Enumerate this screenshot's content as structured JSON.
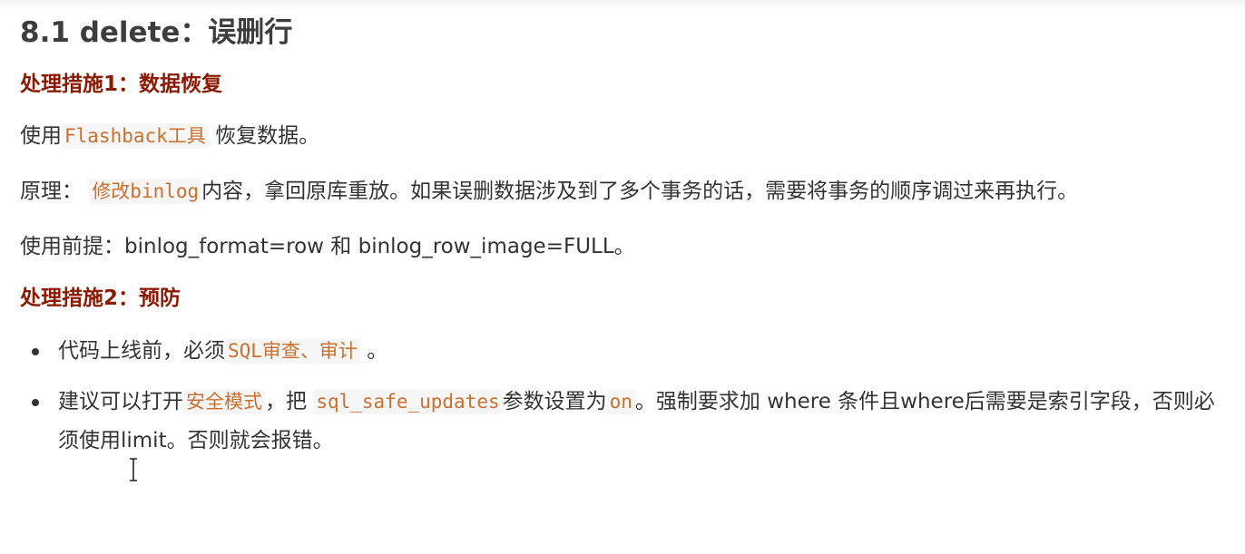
{
  "title": "8.1 delete：误删行",
  "measure1": {
    "label": "处理措施1：数据恢复"
  },
  "para_tool": {
    "prefix": "使用",
    "code": "Flashback工具",
    "suffix": "恢复数据。"
  },
  "para_principle": {
    "prefix": "原理：",
    "code": "修改binlog",
    "suffix": "内容，拿回原库重放。如果误删数据涉及到了多个事务的话，需要将事务的顺序调过来再执行。"
  },
  "para_premise": {
    "text": "使用前提：binlog_format=row 和 binlog_row_image=FULL。"
  },
  "measure2": {
    "label": "处理措施2：预防"
  },
  "bullets": [
    {
      "prefix": "代码上线前，必须",
      "code": "SQL审查、审计",
      "suffix": "。"
    },
    {
      "prefix": "建议可以打开",
      "code1": "安全模式",
      "mid1": "，把",
      "code2": "sql_safe_updates",
      "mid2": "参数设置为",
      "code3": "on",
      "suffix": "。强制要求加 where 条件且where后需要是索引字段，否则必须使用limit。否则就会报错。"
    }
  ],
  "icons": {
    "cursor": "text-cursor-icon"
  },
  "colors": {
    "heading": "#3d3d3d",
    "measure": "#8b1a05",
    "code": "#c7702f",
    "code_bg": "#f6f6f6",
    "text": "#333333"
  }
}
